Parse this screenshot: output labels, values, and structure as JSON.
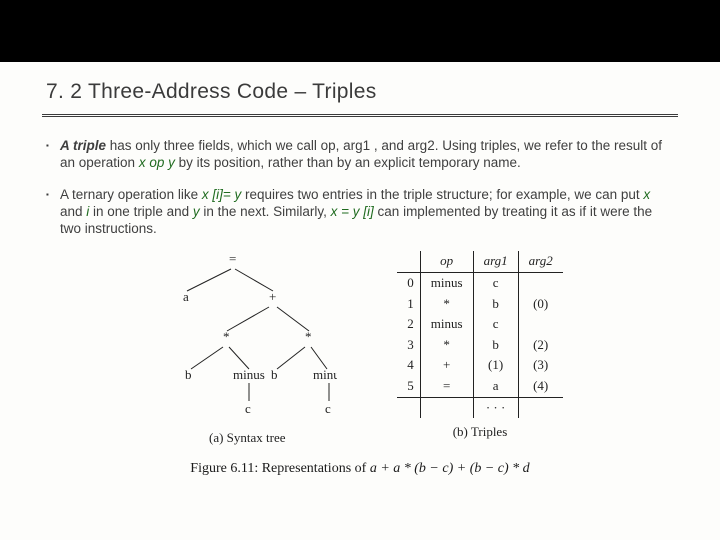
{
  "title": "7. 2 Three-Address Code – Triples",
  "bullets": {
    "b1": {
      "t1": "A triple",
      "t2": " has only three fields, which we call op, arg1 , and arg2. Using triples, we refer to the result of an operation ",
      "t3": "x op y",
      "t4": " by its position, rather than by an explicit temporary name."
    },
    "b2": {
      "t1": "A ternary operation like ",
      "t2": "x [i]= y",
      "t3": " requires two entries in the triple structure; for example, we can put ",
      "t4": "x",
      "t5": " and ",
      "t6": "i",
      "t7": " in one triple and ",
      "t8": "y",
      "t9": " in the next. Similarly, ",
      "t10": "x = y [i]",
      "t11": " can implemented by treating it as if it were the two instructions."
    }
  },
  "tree": {
    "eq": "=",
    "a": "a",
    "plus": "+",
    "star": "*",
    "b": "b",
    "minus": "minus",
    "c": "c"
  },
  "triples": {
    "head": {
      "op": "op",
      "arg1": "arg1",
      "arg2": "arg2"
    },
    "rows": [
      {
        "i": "0",
        "op": "minus",
        "a1": "c",
        "a2": ""
      },
      {
        "i": "1",
        "op": "*",
        "a1": "b",
        "a2": "(0)"
      },
      {
        "i": "2",
        "op": "minus",
        "a1": "c",
        "a2": ""
      },
      {
        "i": "3",
        "op": "*",
        "a1": "b",
        "a2": "(2)"
      },
      {
        "i": "4",
        "op": "+",
        "a1": "(1)",
        "a2": "(3)"
      },
      {
        "i": "5",
        "op": "=",
        "a1": "a",
        "a2": "(4)"
      }
    ],
    "dots": "· · ·"
  },
  "captions": {
    "a": "(a) Syntax tree",
    "b": "(b) Triples",
    "fig_label": "Figure 6.11: Representations of ",
    "fig_expr": "a + a * (b − c) + (b − c) * d"
  }
}
